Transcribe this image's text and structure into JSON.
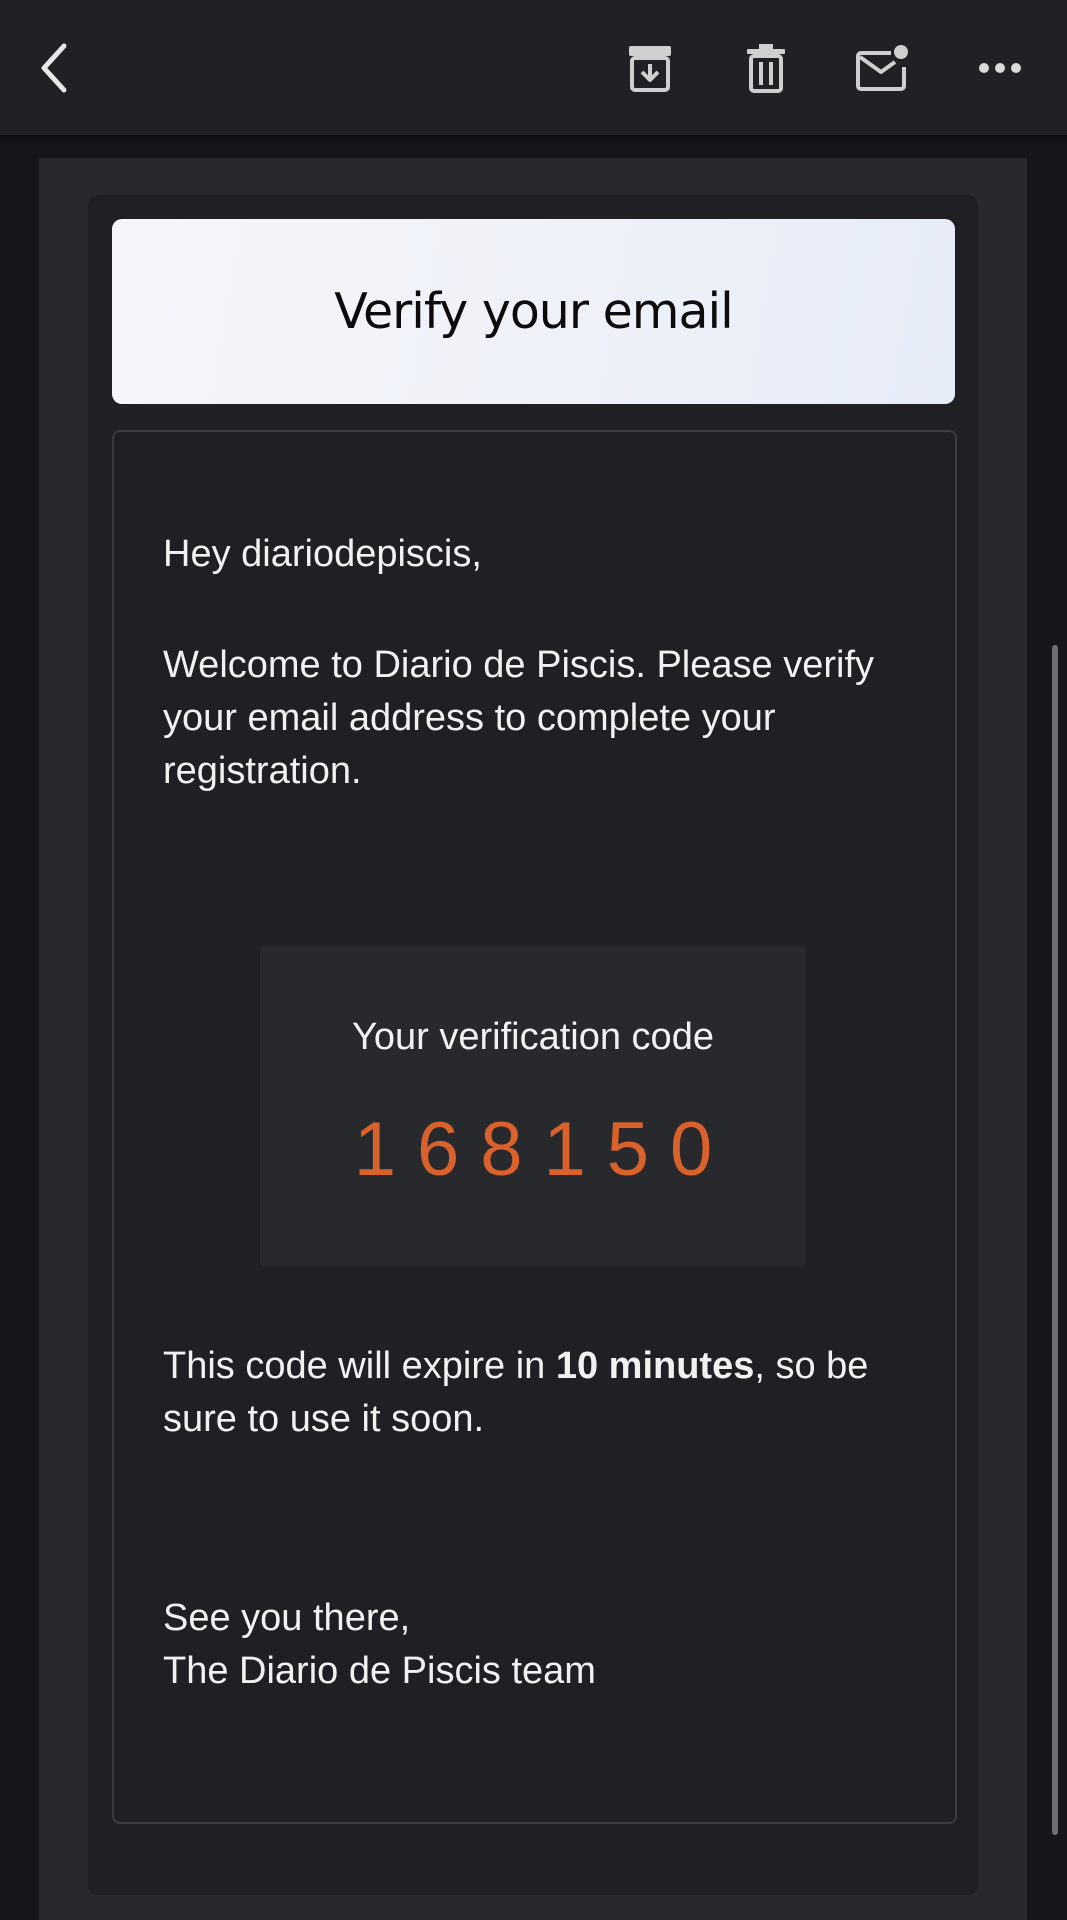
{
  "toolbar": {
    "back_icon": "chevron-left-icon",
    "archive_icon": "archive-icon",
    "delete_icon": "trash-icon",
    "mark_unread_icon": "mail-unread-icon",
    "more_icon": "more-horizontal-icon"
  },
  "email": {
    "header_title": "Verify your email",
    "greeting": "Hey diariodepiscis,",
    "welcome_text": "Welcome to Diario de Piscis. Please verify your email address to complete your registration.",
    "code_label": "Your verification code",
    "code_value": "168150",
    "expire_prefix": "This code will expire in ",
    "expire_duration": "10 minutes",
    "expire_suffix": ", so be sure to use it soon.",
    "signoff_line1": "See you there,",
    "signoff_line2": "The Diario de Piscis team"
  },
  "colors": {
    "background": "#151619",
    "toolbar": "#202124",
    "card": "#1f2023",
    "code_accent": "#d9622c",
    "banner": "#eef1f8"
  }
}
